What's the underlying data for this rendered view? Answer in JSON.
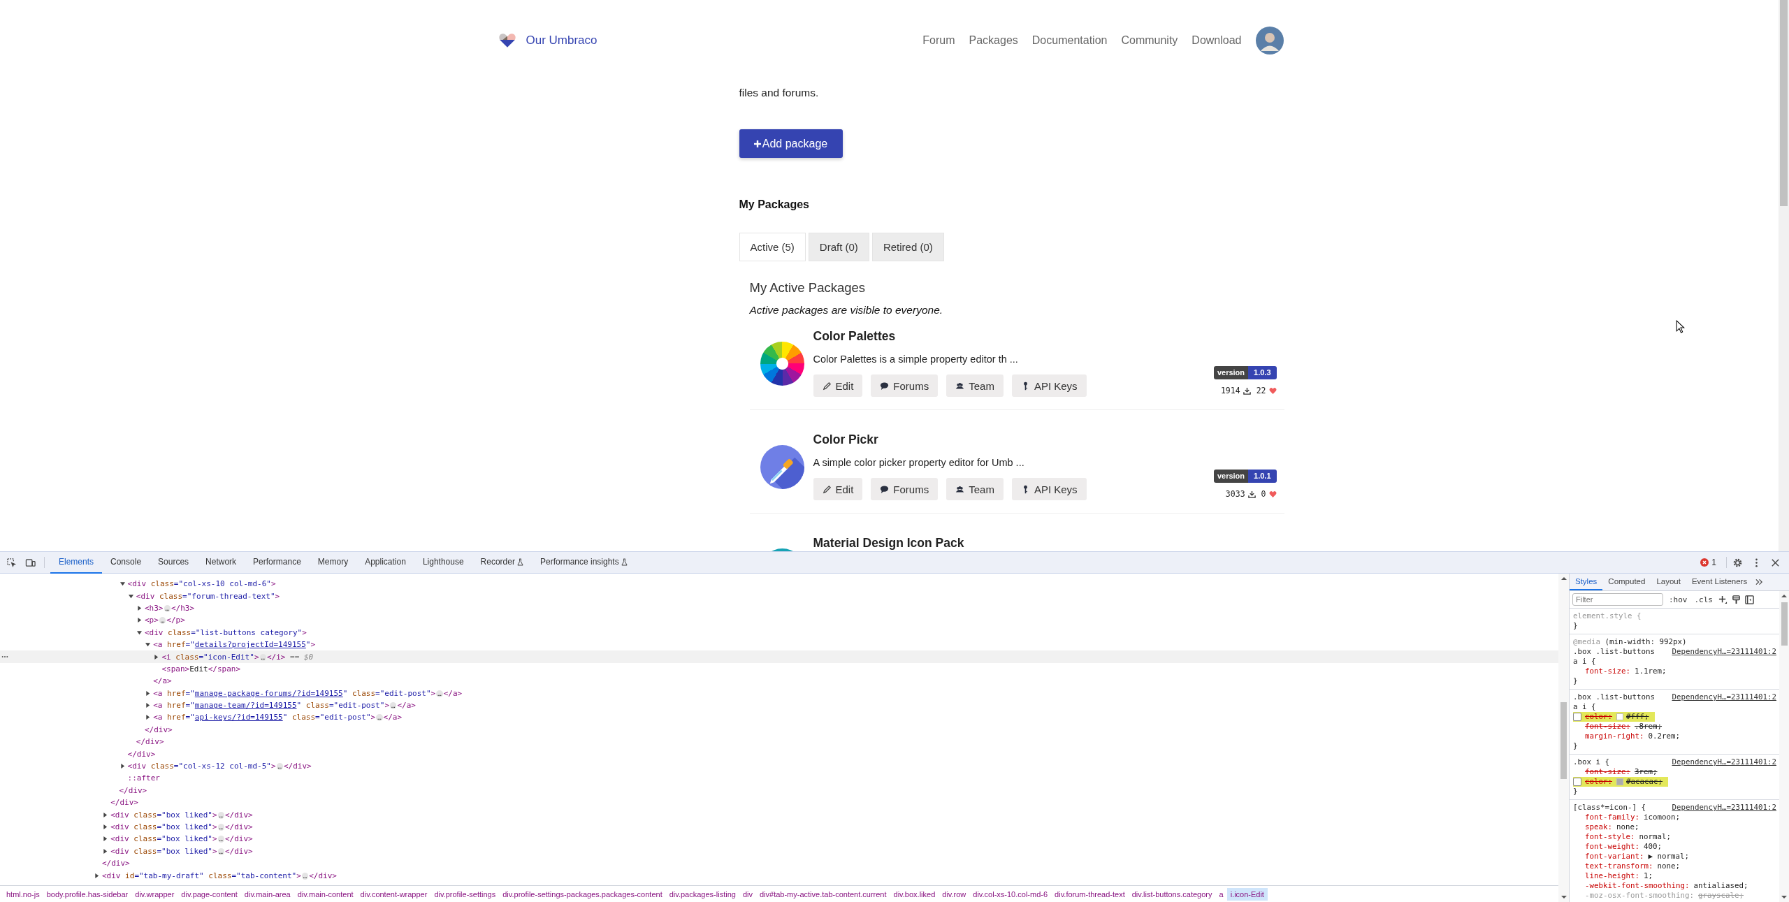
{
  "page": {
    "header": {
      "logo_text": "Our Umbraco",
      "nav": [
        "Forum",
        "Packages",
        "Documentation",
        "Community",
        "Download"
      ]
    },
    "intro": "files and forums.",
    "add_button": "Add package",
    "section_title": "My Packages",
    "tabs": [
      {
        "label": "Active (5)",
        "selected": true
      },
      {
        "label": "Draft (0)",
        "selected": false
      },
      {
        "label": "Retired (0)",
        "selected": false
      }
    ],
    "list_title": "My Active Packages",
    "list_note": "Active packages are visible to everyone.",
    "packages": [
      {
        "name": "Color Palettes",
        "kind": "wheel",
        "description": "Color Palettes is a simple property editor th ...",
        "buttons": [
          {
            "label": "Edit",
            "kind": "pencil"
          },
          {
            "label": "Forums",
            "kind": "bubble"
          },
          {
            "label": "Team",
            "kind": "team"
          },
          {
            "label": "API Keys",
            "kind": "key"
          }
        ],
        "version_label": "version",
        "version": "1.0.3",
        "downloads": "1914",
        "likes": "22"
      },
      {
        "name": "Color Pickr",
        "kind": "dropper",
        "description": "A simple color picker property editor for Umb ...",
        "buttons": [
          {
            "label": "Edit",
            "kind": "pencil"
          },
          {
            "label": "Forums",
            "kind": "bubble"
          },
          {
            "label": "Team",
            "kind": "team"
          },
          {
            "label": "API Keys",
            "kind": "key"
          }
        ],
        "version_label": "version",
        "version": "1.0.1",
        "downloads": "3033",
        "likes": "0"
      },
      {
        "name": "Material Design Icon Pack",
        "kind": "round"
      }
    ]
  },
  "devtools": {
    "tabs": [
      {
        "label": "Elements",
        "selected": true,
        "experimental": false
      },
      {
        "label": "Console",
        "selected": false,
        "experimental": false
      },
      {
        "label": "Sources",
        "selected": false,
        "experimental": false
      },
      {
        "label": "Network",
        "selected": false,
        "experimental": false
      },
      {
        "label": "Performance",
        "selected": false,
        "experimental": false
      },
      {
        "label": "Memory",
        "selected": false,
        "experimental": false
      },
      {
        "label": "Application",
        "selected": false,
        "experimental": false
      },
      {
        "label": "Lighthouse",
        "selected": false,
        "experimental": false
      },
      {
        "label": "Recorder",
        "selected": false,
        "experimental": true
      },
      {
        "label": "Performance insights",
        "selected": false,
        "experimental": true
      }
    ],
    "error_count": "1",
    "nodes": [
      {
        "children": [
          {
            "children": [
              {
                "children": [
                  {
                    "line": [
                      {
                        "kind": "tag",
                        "text": "<div"
                      },
                      {
                        "kind": "attr",
                        "text": " class"
                      },
                      {
                        "kind": "val",
                        "text": "=\"col-xs-10 col-md-6\""
                      },
                      {
                        "kind": "tag",
                        "text": ">"
                      }
                    ],
                    "selected": false,
                    "expanded": true,
                    "children": [
                      {
                        "line": [
                          {
                            "kind": "tag",
                            "text": "<div"
                          },
                          {
                            "kind": "attr",
                            "text": " class"
                          },
                          {
                            "kind": "val",
                            "text": "=\"forum-thread-text\""
                          },
                          {
                            "kind": "tag",
                            "text": ">"
                          }
                        ],
                        "selected": false,
                        "expanded": true,
                        "children": [
                          {
                            "line": [
                              {
                                "kind": "tag",
                                "text": "<h3>"
                              },
                              {
                                "kind": "ell",
                                "text": "…"
                              },
                              {
                                "kind": "tag",
                                "text": "</h3>"
                              }
                            ],
                            "selected": false,
                            "expanded": false
                          },
                          {
                            "line": [
                              {
                                "kind": "tag",
                                "text": "<p>"
                              },
                              {
                                "kind": "ell",
                                "text": "…"
                              },
                              {
                                "kind": "tag",
                                "text": "</p>"
                              }
                            ],
                            "selected": false,
                            "expanded": false
                          },
                          {
                            "line": [
                              {
                                "kind": "tag",
                                "text": "<div"
                              },
                              {
                                "kind": "attr",
                                "text": " class"
                              },
                              {
                                "kind": "val",
                                "text": "=\"list-buttons category\""
                              },
                              {
                                "kind": "tag",
                                "text": ">"
                              }
                            ],
                            "selected": false,
                            "expanded": true,
                            "children": [
                              {
                                "line": [
                                  {
                                    "kind": "tag",
                                    "text": "<a"
                                  },
                                  {
                                    "kind": "attr",
                                    "text": " href"
                                  },
                                  {
                                    "kind": "val",
                                    "text": "=\""
                                  },
                                  {
                                    "kind": "link",
                                    "text": "details?projectId=149155"
                                  },
                                  {
                                    "kind": "val",
                                    "text": "\""
                                  },
                                  {
                                    "kind": "tag",
                                    "text": ">"
                                  }
                                ],
                                "selected": false,
                                "expanded": true,
                                "children": [
                                  {
                                    "line": [
                                      {
                                        "kind": "tag",
                                        "text": "<i"
                                      },
                                      {
                                        "kind": "attr",
                                        "text": " class"
                                      },
                                      {
                                        "kind": "val",
                                        "text": "=\"icon-Edit\""
                                      },
                                      {
                                        "kind": "tag",
                                        "text": ">"
                                      },
                                      {
                                        "kind": "ell",
                                        "text": "…"
                                      },
                                      {
                                        "kind": "tag",
                                        "text": "</i>"
                                      },
                                      {
                                        "kind": "dim",
                                        "text": " == $0"
                                      }
                                    ],
                                    "selected": true,
                                    "expanded": false
                                  },
                                  {
                                    "line": [
                                      {
                                        "kind": "tag",
                                        "text": "<span>"
                                      },
                                      {
                                        "kind": "text",
                                        "text": "Edit"
                                      },
                                      {
                                        "kind": "tag",
                                        "text": "</span>"
                                      }
                                    ],
                                    "selected": false
                                  }
                                ],
                                "close": [
                                  {
                                    "kind": "tag",
                                    "text": "</a>"
                                  }
                                ]
                              },
                              {
                                "line": [
                                  {
                                    "kind": "tag",
                                    "text": "<a"
                                  },
                                  {
                                    "kind": "attr",
                                    "text": " href"
                                  },
                                  {
                                    "kind": "val",
                                    "text": "=\""
                                  },
                                  {
                                    "kind": "link",
                                    "text": "manage-package-forums/?id=149155"
                                  },
                                  {
                                    "kind": "val",
                                    "text": "\""
                                  },
                                  {
                                    "kind": "attr",
                                    "text": " class"
                                  },
                                  {
                                    "kind": "val",
                                    "text": "=\"edit-post\""
                                  },
                                  {
                                    "kind": "tag",
                                    "text": ">"
                                  },
                                  {
                                    "kind": "ell",
                                    "text": "…"
                                  },
                                  {
                                    "kind": "tag",
                                    "text": "</a>"
                                  }
                                ],
                                "selected": false,
                                "expanded": false
                              },
                              {
                                "line": [
                                  {
                                    "kind": "tag",
                                    "text": "<a"
                                  },
                                  {
                                    "kind": "attr",
                                    "text": " href"
                                  },
                                  {
                                    "kind": "val",
                                    "text": "=\""
                                  },
                                  {
                                    "kind": "link",
                                    "text": "manage-team/?id=149155"
                                  },
                                  {
                                    "kind": "val",
                                    "text": "\""
                                  },
                                  {
                                    "kind": "attr",
                                    "text": " class"
                                  },
                                  {
                                    "kind": "val",
                                    "text": "=\"edit-post\""
                                  },
                                  {
                                    "kind": "tag",
                                    "text": ">"
                                  },
                                  {
                                    "kind": "ell",
                                    "text": "…"
                                  },
                                  {
                                    "kind": "tag",
                                    "text": "</a>"
                                  }
                                ],
                                "selected": false,
                                "expanded": false
                              },
                              {
                                "line": [
                                  {
                                    "kind": "tag",
                                    "text": "<a"
                                  },
                                  {
                                    "kind": "attr",
                                    "text": " href"
                                  },
                                  {
                                    "kind": "val",
                                    "text": "=\""
                                  },
                                  {
                                    "kind": "link",
                                    "text": "api-keys/?id=149155"
                                  },
                                  {
                                    "kind": "val",
                                    "text": "\""
                                  },
                                  {
                                    "kind": "attr",
                                    "text": " class"
                                  },
                                  {
                                    "kind": "val",
                                    "text": "=\"edit-post\""
                                  },
                                  {
                                    "kind": "tag",
                                    "text": ">"
                                  },
                                  {
                                    "kind": "ell",
                                    "text": "…"
                                  },
                                  {
                                    "kind": "tag",
                                    "text": "</a>"
                                  }
                                ],
                                "selected": false,
                                "expanded": false
                              }
                            ],
                            "close": [
                              {
                                "kind": "tag",
                                "text": "</div>"
                              }
                            ]
                          }
                        ],
                        "close": [
                          {
                            "kind": "tag",
                            "text": "</div>"
                          }
                        ]
                      }
                    ],
                    "close": [
                      {
                        "kind": "tag",
                        "text": "</div>"
                      }
                    ]
                  },
                  {
                    "line": [
                      {
                        "kind": "tag",
                        "text": "<div"
                      },
                      {
                        "kind": "attr",
                        "text": " class"
                      },
                      {
                        "kind": "val",
                        "text": "=\"col-xs-12 col-md-5\""
                      },
                      {
                        "kind": "tag",
                        "text": ">"
                      },
                      {
                        "kind": "ell",
                        "text": "…"
                      },
                      {
                        "kind": "tag",
                        "text": "</div>"
                      }
                    ],
                    "selected": false,
                    "expanded": false
                  },
                  {
                    "line": [
                      {
                        "kind": "pseudo",
                        "text": "::after"
                      }
                    ],
                    "selected": false
                  }
                ],
                "close": [
                  {
                    "kind": "tag",
                    "text": "</div>"
                  }
                ]
              }
            ],
            "close": [
              {
                "kind": "tag",
                "text": "</div>"
              }
            ]
          },
          {
            "line": [
              {
                "kind": "tag",
                "text": "<div"
              },
              {
                "kind": "attr",
                "text": " class"
              },
              {
                "kind": "val",
                "text": "=\"box liked\""
              },
              {
                "kind": "tag",
                "text": ">"
              },
              {
                "kind": "ell",
                "text": "…"
              },
              {
                "kind": "tag",
                "text": "</div>"
              }
            ],
            "selected": false,
            "expanded": false
          },
          {
            "line": [
              {
                "kind": "tag",
                "text": "<div"
              },
              {
                "kind": "attr",
                "text": " class"
              },
              {
                "kind": "val",
                "text": "=\"box liked\""
              },
              {
                "kind": "tag",
                "text": ">"
              },
              {
                "kind": "ell",
                "text": "…"
              },
              {
                "kind": "tag",
                "text": "</div>"
              }
            ],
            "selected": false,
            "expanded": false
          },
          {
            "line": [
              {
                "kind": "tag",
                "text": "<div"
              },
              {
                "kind": "attr",
                "text": " class"
              },
              {
                "kind": "val",
                "text": "=\"box liked\""
              },
              {
                "kind": "tag",
                "text": ">"
              },
              {
                "kind": "ell",
                "text": "…"
              },
              {
                "kind": "tag",
                "text": "</div>"
              }
            ],
            "selected": false,
            "expanded": false
          },
          {
            "line": [
              {
                "kind": "tag",
                "text": "<div"
              },
              {
                "kind": "attr",
                "text": " class"
              },
              {
                "kind": "val",
                "text": "=\"box liked\""
              },
              {
                "kind": "tag",
                "text": ">"
              },
              {
                "kind": "ell",
                "text": "…"
              },
              {
                "kind": "tag",
                "text": "</div>"
              }
            ],
            "selected": false,
            "expanded": false
          }
        ],
        "close": [
          {
            "kind": "tag",
            "text": "</div>"
          }
        ]
      },
      {
        "line": [
          {
            "kind": "tag",
            "text": "<div"
          },
          {
            "kind": "attr",
            "text": " id"
          },
          {
            "kind": "val",
            "text": "=\"tab-my-draft\""
          },
          {
            "kind": "attr",
            "text": " class"
          },
          {
            "kind": "val",
            "text": "=\"tab-content\""
          },
          {
            "kind": "tag",
            "text": ">"
          },
          {
            "kind": "ell",
            "text": "…"
          },
          {
            "kind": "tag",
            "text": "</div>"
          }
        ],
        "selected": false,
        "expanded": false
      }
    ],
    "breadcrumb": [
      {
        "label": "html.no-js",
        "selected": false
      },
      {
        "label": "body.profile.has-sidebar",
        "selected": false
      },
      {
        "label": "div.wrapper",
        "selected": false
      },
      {
        "label": "div.page-content",
        "selected": false
      },
      {
        "label": "div.main-area",
        "selected": false
      },
      {
        "label": "div.main-content",
        "selected": false
      },
      {
        "label": "div.content-wrapper",
        "selected": false
      },
      {
        "label": "div.profile-settings",
        "selected": false
      },
      {
        "label": "div.profile-settings-packages.packages-content",
        "selected": false
      },
      {
        "label": "div.packages-listing",
        "selected": false
      },
      {
        "label": "div",
        "selected": false
      },
      {
        "label": "div#tab-my-active.tab-content.current",
        "selected": false
      },
      {
        "label": "div.box.liked",
        "selected": false
      },
      {
        "label": "div.row",
        "selected": false
      },
      {
        "label": "div.col-xs-10.col-md-6",
        "selected": false
      },
      {
        "label": "div.forum-thread-text",
        "selected": false
      },
      {
        "label": "div.list-buttons.category",
        "selected": false
      },
      {
        "label": "a",
        "selected": false
      },
      {
        "label": "i.icon-Edit",
        "selected": true
      }
    ],
    "styles": {
      "tabs": [
        {
          "label": "Styles",
          "selected": true
        },
        {
          "label": "Computed",
          "selected": false
        },
        {
          "label": "Layout",
          "selected": false
        },
        {
          "label": "Event Listeners",
          "selected": false
        }
      ],
      "filter": {
        "placeholder": "Filter"
      },
      "hov": ":hov",
      "cls": ".cls",
      "rules": [
        {
          "kind": "inline",
          "selector": "element.style {",
          "close": "}"
        },
        {
          "kind": "rule",
          "media": "@media",
          "media_query": "(min-width: 992px)",
          "selector": ".box .list-buttons a i {",
          "source": "DependencyH…=23111401:2",
          "close": "}",
          "declarations": [
            {
              "prop": "font-size:",
              "value": "1.1rem;",
              "kind": "active",
              "highlighted": false
            }
          ]
        },
        {
          "kind": "rule",
          "selector": ".box .list-buttons a i {",
          "source": "DependencyH…=23111401:2",
          "close": "}",
          "declarations": [
            {
              "prop": "color:",
              "value": "#fff;",
              "kind": "overridden",
              "highlighted": true,
              "checked": false,
              "color": "#ffffff"
            },
            {
              "prop": "font-size:",
              "value": ".8rem;",
              "kind": "overridden",
              "highlighted": false
            },
            {
              "prop": "margin-right:",
              "value": "0.2rem;",
              "kind": "active",
              "highlighted": false
            }
          ]
        },
        {
          "kind": "rule",
          "selector": ".box i {",
          "source": "DependencyH…=23111401:2",
          "close": "}",
          "declarations": [
            {
              "prop": "font-size:",
              "value": "3rem;",
              "kind": "overridden",
              "highlighted": false
            },
            {
              "prop": "color:",
              "value": "#acacac;",
              "kind": "overridden",
              "highlighted": true,
              "checked": false,
              "color": "#acacac"
            }
          ]
        },
        {
          "kind": "rule",
          "selector": "[class*=icon-] {",
          "source": "DependencyH…=23111401:2",
          "declarations": [
            {
              "prop": "font-family:",
              "value": "icomoon;",
              "kind": "active",
              "highlighted": false
            },
            {
              "prop": "speak:",
              "value": "none;",
              "kind": "active",
              "highlighted": false
            },
            {
              "prop": "font-style:",
              "value": "normal;",
              "kind": "active",
              "highlighted": false
            },
            {
              "prop": "font-weight:",
              "value": "400;",
              "kind": "active",
              "highlighted": false
            },
            {
              "prop": "font-variant:",
              "value": "▶ normal;",
              "kind": "active",
              "highlighted": false
            },
            {
              "prop": "text-transform:",
              "value": "none;",
              "kind": "active",
              "highlighted": false
            },
            {
              "prop": "line-height:",
              "value": "1;",
              "kind": "active",
              "highlighted": false
            },
            {
              "prop": "-webkit-font-smoothing:",
              "value": "antialiased;",
              "kind": "active",
              "highlighted": false
            },
            {
              "prop": "-moz-osx-font-smoothing:",
              "value": "grayscale;",
              "kind": "unsupported",
              "highlighted": false
            }
          ]
        }
      ]
    }
  }
}
